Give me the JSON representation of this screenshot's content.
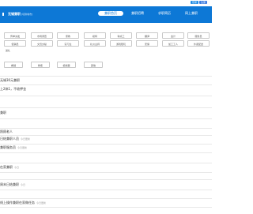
{
  "top_actions": {
    "login": "登录",
    "register": "注册"
  },
  "brand": {
    "name": "无锡兼职",
    "subtitle": "[切换城市]",
    "color": "#0d78d6"
  },
  "nav": [
    {
      "label": "兼职首页"
    },
    {
      "label": "兼职招聘"
    },
    {
      "label": "求职简历"
    },
    {
      "label": "网上兼职"
    }
  ],
  "category_rows": [
    [
      "传单派发",
      "市场调查",
      "家教",
      "模特",
      "钟点工",
      "翻译",
      "会计",
      "服务员"
    ],
    [
      "促销员",
      "文员文秘",
      "实习生",
      "礼仪主持",
      "游戏陪玩",
      "安保",
      "加工工人",
      "外卖配送"
    ],
    [
      "送礼"
    ],
    [
      "看铺",
      "教练",
      "模拟器",
      "其他"
    ]
  ],
  "list_items": [
    {
      "text": "无锡30元兼职",
      "sub": ""
    },
    {
      "text": "上2休1，不收押金",
      "sub": ""
    },
    {
      "text": "",
      "sub": ""
    },
    {
      "text": "兼职",
      "sub": ""
    },
    {
      "text": "",
      "sub": ""
    },
    {
      "text": "照顾老人",
      "sub": ""
    },
    {
      "text": "日结兼职人员",
      "sub": "今日更新"
    },
    {
      "text": "兼职服务员",
      "sub": "今日更新"
    },
    {
      "text": "",
      "sub": ""
    },
    {
      "text": "在家兼职",
      "sub": "今日"
    },
    {
      "text": "",
      "sub": ""
    },
    {
      "text": "周末日结兼职",
      "sub": "今日"
    },
    {
      "text": "",
      "sub": ""
    },
    {
      "text": "线上操作兼职在家做任务",
      "sub": "今日更新"
    }
  ]
}
